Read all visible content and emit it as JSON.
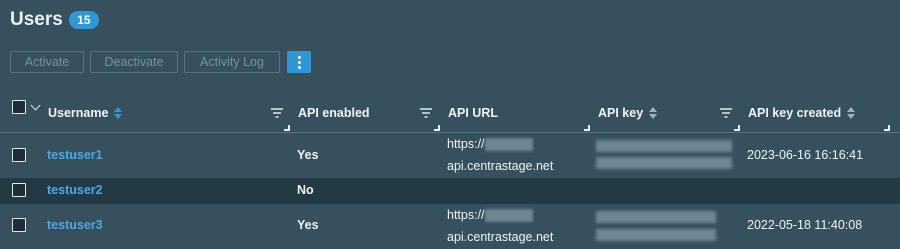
{
  "header": {
    "title": "Users",
    "count": "15"
  },
  "toolbar": {
    "activate": "Activate",
    "deactivate": "Deactivate",
    "activity_log": "Activity Log"
  },
  "columns": {
    "username": "Username",
    "api_enabled": "API enabled",
    "api_url": "API URL",
    "api_key": "API key",
    "api_key_created": "API key created"
  },
  "rows": [
    {
      "username": "testuser1",
      "api_enabled": "Yes",
      "url_prefix": "https://",
      "url_host": "api.centrastage.net",
      "api_key_created": "2023-06-16 16:16:41"
    },
    {
      "username": "testuser2",
      "api_enabled": "No",
      "url_prefix": "",
      "url_host": "",
      "api_key_created": ""
    },
    {
      "username": "testuser3",
      "api_enabled": "Yes",
      "url_prefix": "https://",
      "url_host": "api.centrastage.net",
      "api_key_created": "2022-05-18 11:40:08"
    }
  ],
  "colors": {
    "background": "#37505d",
    "accent": "#2f97d6",
    "link": "#4aa8e6",
    "alt_row": "#233a45"
  }
}
